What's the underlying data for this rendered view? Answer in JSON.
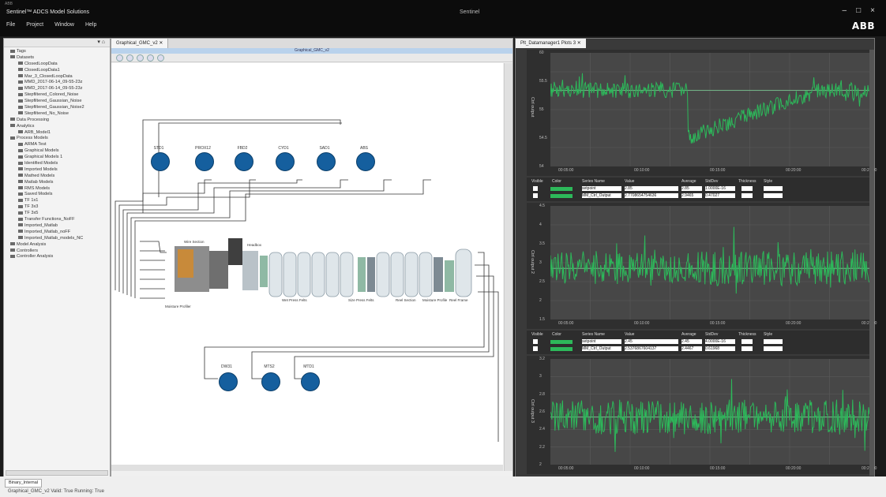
{
  "window": {
    "small_caption": "ABB",
    "app_title": "Sentinel™ ADCS Model Solutions",
    "center_title": "Sentinel",
    "controls": [
      "–",
      "□",
      "×"
    ],
    "logo": "ABB"
  },
  "menu": [
    "File",
    "Project",
    "Window",
    "Help"
  ],
  "tree": {
    "header_icons": "▾ ⌂",
    "items": [
      "Tags",
      "Datasets",
      "ClosedLoopData",
      "ClosedLoopData1",
      "Mar_3_ClosedLoopData",
      "MMD_2017-06-14_09-55-23z",
      "MMD_2017-06-14_09-55-23z",
      "Stepfiltered_Colored_Noise",
      "Stepfiltered_Gaussian_Noise",
      "Stepfiltered_Gaussian_Noise2",
      "Stepfiltered_No_Noise",
      "Data Processing",
      "Analytics",
      "ARB_Model1",
      "Process Models",
      "ARMA Test",
      "Graphical Models",
      "Graphical Models 1",
      "Identified Models",
      "Imported Models",
      "Mathed Models",
      "Matlab Models",
      "RMS Models",
      "Saved Models",
      "TF 1x1",
      "TF 3x3",
      "TF 3x5",
      "Transfer Functions_NoFF",
      "Imported_Matlab",
      "Imported_Matlab_noFF",
      "Imported_Matlab_models_NC",
      "Model Analysis",
      "Controllers",
      "Controller Analysis"
    ]
  },
  "editor": {
    "tab": "Graphical_GMC_v2 ✕",
    "bar_title": "Graphical_GMC_v2",
    "nodes_top": [
      "STD1",
      "PROX12",
      "FBD2",
      "CYD1",
      "SAD1",
      "ABS"
    ],
    "nodes_bottom": [
      "DW31",
      "MTS2",
      "MTD1"
    ],
    "process_labels": [
      "Wire Section",
      "Headbox",
      "Wet Press Felts",
      "Size Press Felts",
      "Reel Section",
      "Moisture Profile",
      "Reel Frame",
      "Moisture Profiler"
    ]
  },
  "plots": {
    "tab": "Plt_Datamanager1 Plots 3 ✕",
    "charts": [
      {
        "ylabel": "Ctrl output",
        "yticks": [
          "60",
          "55.5",
          "55",
          "54.5",
          "54"
        ],
        "xticks": [
          "00:05:00",
          "00:10:00",
          "00:15:00",
          "00:20:00",
          "00:25:00"
        ]
      },
      {
        "ylabel": "Ctrl output 2",
        "yticks": [
          "4.5",
          "4",
          "3.5",
          "3",
          "2.5",
          "2",
          "1.5"
        ],
        "xticks": [
          "00:05:00",
          "00:10:00",
          "00:15:00",
          "00:20:00",
          "00:25:00"
        ]
      },
      {
        "ylabel": "Ctrl output 3",
        "yticks": [
          "3.2",
          "3",
          "2.8",
          "2.6",
          "2.4",
          "2.2",
          "2"
        ],
        "xticks": [
          "00:05:00",
          "00:10:00",
          "00:15:00",
          "00:20:00",
          "00:25:00"
        ]
      }
    ],
    "legend_header": [
      "Visible",
      "Color",
      "Series Name",
      "Value",
      "Average",
      "StdDev",
      "Thickness",
      "Style"
    ],
    "legends": [
      [
        [
          "setpoint",
          "2.85",
          "2.85",
          "1.0000E-16"
        ],
        [
          "MM_Ctrl_Output",
          "2.7708654754636",
          "2.9465",
          "0.47027"
        ]
      ],
      [
        [
          "setpoint",
          "2.45",
          "2.45",
          "4.0000E-16"
        ],
        [
          "MM_Ctrl_Output",
          "2.5376867604137",
          "2.4467",
          "0.61968"
        ]
      ]
    ],
    "series_color": "#2db85a"
  },
  "bottom": {
    "tab": "Binary_Internal",
    "status": "Graphical_GMC_v2   Valid: True   Running: True"
  }
}
